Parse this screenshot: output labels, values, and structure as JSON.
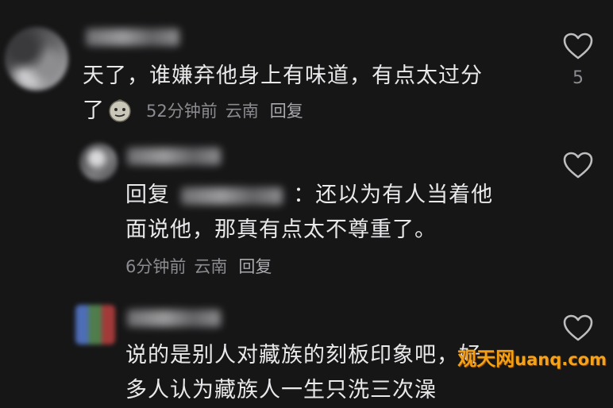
{
  "comments": [
    {
      "text_line1": "天了，谁嫌弃他身上有味道，有点太过分",
      "text_line2": "了",
      "emoji": "smirk-emoji-icon",
      "time": "52分钟前",
      "location": "云南",
      "reply_label": "回复",
      "likes": "5"
    },
    {
      "reply_prefix": "回复",
      "reply_separator": "：",
      "text_line1": "还以为有人当着他",
      "text_line2": "面说他，那真有点太不尊重了。",
      "time": "6分钟前",
      "location": "云南",
      "reply_label": "回复"
    },
    {
      "text_line1": "说的是别人对藏族的刻板印象吧，好",
      "text_line2": "多人认为藏族人一生只洗三次澡"
    }
  ],
  "watermark": {
    "cn": "观天网",
    "en": "uanq.com"
  },
  "colors": {
    "background": "#161617",
    "text": "#e9e9eb",
    "meta": "#8b8b90",
    "watermark": "#f5a21b"
  }
}
